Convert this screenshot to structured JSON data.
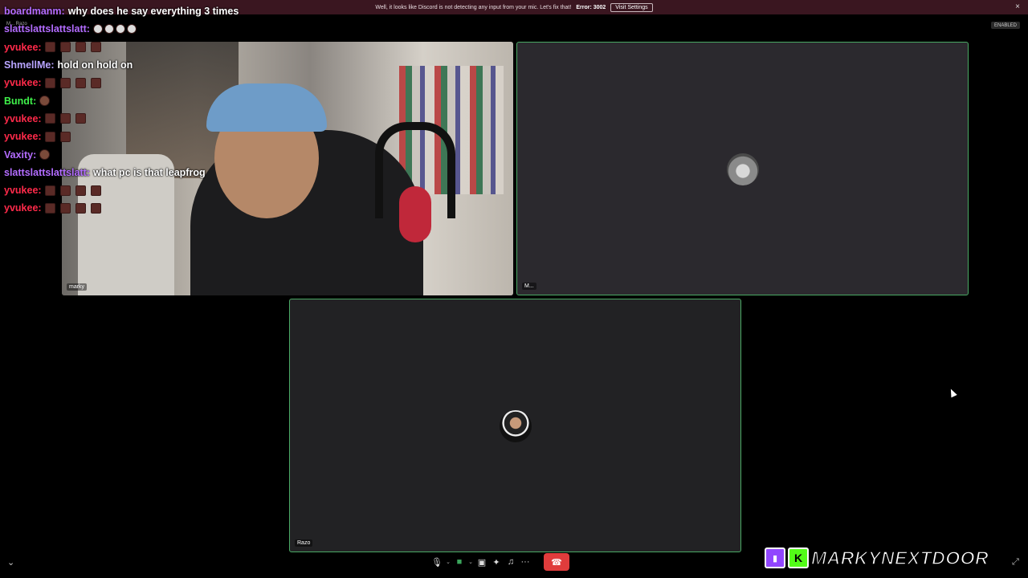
{
  "notice": {
    "message": "Well, it looks like Discord is not detecting any input from your mic. Let's fix that!",
    "error": "Error: 3002",
    "button": "Visit Settings",
    "close_icon": "×"
  },
  "enabled_badge": "ENABLED",
  "tiny_user": "M... Razo",
  "tiles": {
    "cam_name": "marky",
    "m_name": "M...",
    "razo_name": "Razo"
  },
  "chat": [
    {
      "user": "boardmanm:",
      "color": "#b36cff",
      "text": "why does he say everything 3 times",
      "emotes": 0,
      "emote_type": ""
    },
    {
      "user": "slattslattslattslatt:",
      "color": "#b36cff",
      "text": "",
      "emotes": 4,
      "emote_type": "grin"
    },
    {
      "user": "yvukee:",
      "color": "#ff2a4a",
      "text": "",
      "emotes": 4,
      "emote_type": "box"
    },
    {
      "user": "ShmellMe:",
      "color": "#b8a4ff",
      "text": "hold on hold on",
      "emotes": 0,
      "emote_type": ""
    },
    {
      "user": "yvukee:",
      "color": "#ff2a4a",
      "text": "",
      "emotes": 4,
      "emote_type": "box"
    },
    {
      "user": "Bundt:",
      "color": "#3ff04a",
      "text": "",
      "emotes": 1,
      "emote_type": "face"
    },
    {
      "user": "yvukee:",
      "color": "#ff2a4a",
      "text": "",
      "emotes": 3,
      "emote_type": "box"
    },
    {
      "user": "yvukee:",
      "color": "#ff2a4a",
      "text": "",
      "emotes": 2,
      "emote_type": "box"
    },
    {
      "user": "Vaxity:",
      "color": "#b36cff",
      "text": "",
      "emotes": 1,
      "emote_type": "face"
    },
    {
      "user": "slattslattslattslatt:",
      "color": "#b36cff",
      "text": "what pc is that leapfrog",
      "emotes": 0,
      "emote_type": ""
    },
    {
      "user": "yvukee:",
      "color": "#ff2a4a",
      "text": "",
      "emotes": 4,
      "emote_type": "box"
    },
    {
      "user": "yvukee:",
      "color": "#ff2a4a",
      "text": "",
      "emotes": 4,
      "emote_type": "box"
    }
  ],
  "controls": {
    "mic_icon": "🎙",
    "dropdown_icon": "⌄",
    "camera_icon": "■",
    "screen_share_icon": "▣",
    "activities_icon": "✦",
    "soundboard_icon": "♫",
    "more_icon": "···",
    "end_call_icon": "☎"
  },
  "collapse_icon": "⌄",
  "fullscreen_icon": "⤢",
  "brand": {
    "twitch_icon": "▮",
    "kick_icon": "K",
    "name": "MARKYNEXTDOOR"
  },
  "colors": {
    "speaking_border": "#4aa964",
    "end_call": "#e03c3c",
    "notice_bg": "#3a1620"
  }
}
